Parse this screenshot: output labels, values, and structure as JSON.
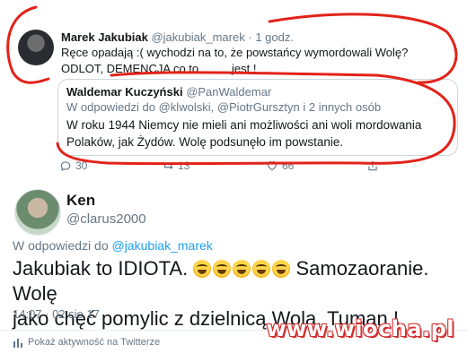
{
  "tweet": {
    "author_name": "Marek Jakubiak",
    "author_handle": "@jakubiak_marek",
    "separator": "·",
    "time": "1 godz.",
    "text_line1": "Ręce opadają :(  wychodzi na to, że powstańcy wymordowali Wolę?",
    "text_line2": "ODLOT, DEMENCJA co to ……. jest !"
  },
  "quote": {
    "author_name": "Waldemar Kuczyński",
    "author_handle": "@PanWaldemar",
    "reply_to": "W odpowiedzi do @klwolski, @PiotrGursztyn i 2 innych osób",
    "text_line1": "W roku 1944 Niemcy nie mieli ani możliwości ani woli mordowania",
    "text_line2": "Polaków, jak Żydów. Wolę podsunęło im powstanie."
  },
  "actions": {
    "replies": "30",
    "retweets": "13",
    "likes": "66"
  },
  "reply": {
    "author_name": "Ken",
    "author_handle": "@clarus2000",
    "reply_to_prefix": "W odpowiedzi do ",
    "reply_to_mention": "@jakubiak_marek",
    "text_part1": "Jakubiak to IDIOTA. ",
    "text_part2": " Samozaoranie. Wolę",
    "text_line2": "jako chęć pomylic z dzielnicą Wola. Tuman !",
    "emoji_count": 5,
    "emoji_icon": "grinning-face-icon",
    "timestamp": "14:07 · 02 sie 17"
  },
  "footer": {
    "analytics_label": "Pokaż aktywność na Twitterze"
  },
  "watermark": "www.wiocha.pl",
  "colors": {
    "link_blue": "#1da1f2",
    "muted_gray": "#657786",
    "annotation_red": "#e2231a"
  }
}
